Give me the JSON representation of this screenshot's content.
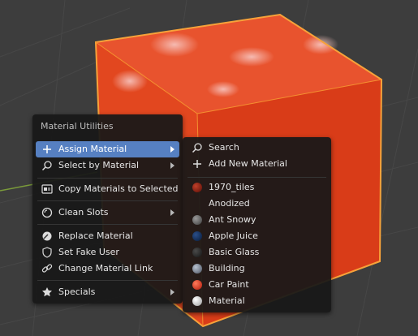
{
  "main_menu": {
    "title": "Material Utilities",
    "items": [
      {
        "label": "Assign Material",
        "icon": "plus-icon",
        "submenu": true,
        "active": true
      },
      {
        "label": "Select by Material",
        "icon": "magnifier-icon",
        "submenu": true
      },
      {
        "label": "Copy Materials to Selected",
        "icon": "copy-materials-icon"
      },
      {
        "label": "Clean Slots",
        "icon": "clean-slots-icon",
        "submenu": true
      },
      {
        "label": "Replace Material",
        "icon": "replace-material-icon"
      },
      {
        "label": "Set Fake User",
        "icon": "shield-icon"
      },
      {
        "label": "Change Material Link",
        "icon": "link-icon"
      },
      {
        "label": "Specials",
        "icon": "star-icon",
        "submenu": true
      }
    ]
  },
  "sub_menu": {
    "search_label": "Search",
    "add_new_label": "Add New Material",
    "materials": [
      {
        "label": "1970_tiles",
        "color": "#8a1a0e"
      },
      {
        "label": "Anodized",
        "color": ""
      },
      {
        "label": "Ant Snowy",
        "color": "#6a6a6a"
      },
      {
        "label": "Apple Juice",
        "color": "#0e2a55"
      },
      {
        "label": "Basic Glass",
        "color": "#2a2a2a"
      },
      {
        "label": "Building",
        "color": "#8a96a8"
      },
      {
        "label": "Car Paint",
        "color": "#d8220e"
      },
      {
        "label": "Material",
        "color": "#d9d9d9"
      }
    ]
  },
  "colors": {
    "accent": "#5680c2",
    "cube_face": "#e3451f",
    "cube_outline": "#f7a23a"
  }
}
